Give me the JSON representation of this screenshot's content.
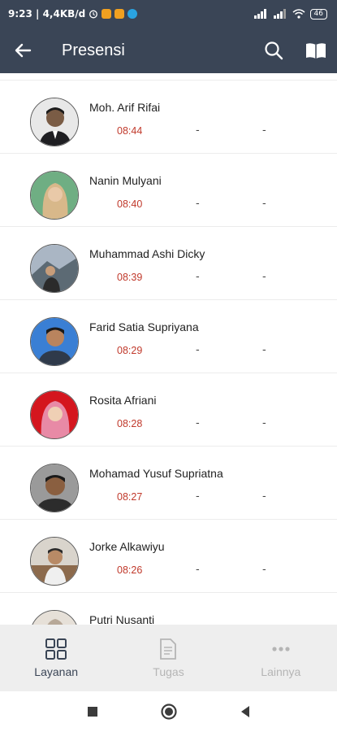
{
  "status_bar": {
    "time_speed": "9:23 | 4,4KB/d",
    "battery": "46"
  },
  "app_bar": {
    "title": "Presensi"
  },
  "students": [
    {
      "name": "Moh. Arif Rifai",
      "time": "08:44",
      "col2": "-",
      "col3": "-"
    },
    {
      "name": "Nanin Mulyani",
      "time": "08:40",
      "col2": "-",
      "col3": "-"
    },
    {
      "name": "Muhammad Ashi Dicky",
      "time": "08:39",
      "col2": "-",
      "col3": "-"
    },
    {
      "name": "Farid Satia Supriyana",
      "time": "08:29",
      "col2": "-",
      "col3": "-"
    },
    {
      "name": "Rosita Afriani",
      "time": "08:28",
      "col2": "-",
      "col3": "-"
    },
    {
      "name": "Mohamad Yusuf Supriatna",
      "time": "08:27",
      "col2": "-",
      "col3": "-"
    },
    {
      "name": "Jorke Alkawiyu",
      "time": "08:26",
      "col2": "-",
      "col3": "-"
    },
    {
      "name": "Putri Nusanti",
      "time": "",
      "col2": "",
      "col3": ""
    }
  ],
  "bottom_nav": {
    "items": [
      {
        "label": "Layanan",
        "icon": "grid-icon",
        "active": true
      },
      {
        "label": "Tugas",
        "icon": "document-icon",
        "active": false
      },
      {
        "label": "Lainnya",
        "icon": "more-icon",
        "active": false
      }
    ]
  },
  "colors": {
    "app_bar": "#3a4556",
    "time_text": "#c0392b",
    "nav_active": "#3a4556",
    "nav_inactive": "#b5b5b5"
  }
}
